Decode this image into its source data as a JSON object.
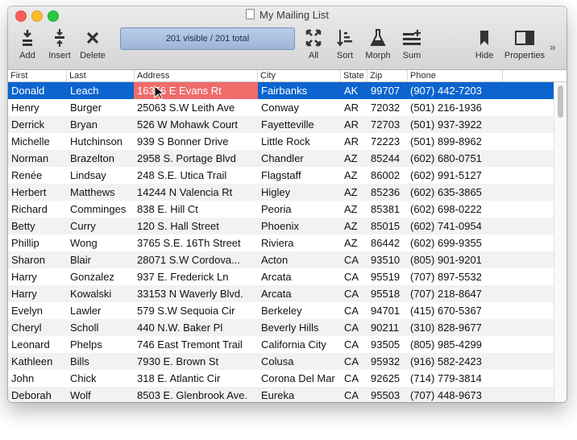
{
  "window": {
    "title": "My Mailing List"
  },
  "toolbar": {
    "add": "Add",
    "insert": "Insert",
    "delete": "Delete",
    "status": "201 visible / 201 total",
    "all": "All",
    "sort": "Sort",
    "morph": "Morph",
    "sum": "Sum",
    "hide": "Hide",
    "properties": "Properties",
    "more": "»"
  },
  "columns": [
    "First",
    "Last",
    "Address",
    "City",
    "State",
    "Zip",
    "Phone"
  ],
  "rows": [
    [
      "Donald",
      "Leach",
      "16356 E Evans Rt",
      "Fairbanks",
      "AK",
      "99707",
      "(907) 442-7203"
    ],
    [
      "Henry",
      "Burger",
      "25063 S.W Leith Ave",
      "Conway",
      "AR",
      "72032",
      "(501) 216-1936"
    ],
    [
      "Derrick",
      "Bryan",
      "526 W Mohawk Court",
      "Fayetteville",
      "AR",
      "72703",
      "(501) 937-3922"
    ],
    [
      "Michelle",
      "Hutchinson",
      "939 S Bonner Drive",
      "Little Rock",
      "AR",
      "72223",
      "(501) 899-8962"
    ],
    [
      "Norman",
      "Brazelton",
      "2958 S. Portage Blvd",
      "Chandler",
      "AZ",
      "85244",
      "(602) 680-0751"
    ],
    [
      "Renée",
      "Lindsay",
      "248 S.E. Utica Trail",
      "Flagstaff",
      "AZ",
      "86002",
      "(602) 991-5127"
    ],
    [
      "Herbert",
      "Matthews",
      "14244 N Valencia Rt",
      "Higley",
      "AZ",
      "85236",
      "(602) 635-3865"
    ],
    [
      "Richard",
      "Comminges",
      "838 E. Hill Ct",
      "Peoria",
      "AZ",
      "85381",
      "(602) 698-0222"
    ],
    [
      "Betty",
      "Curry",
      "120 S. Hall Street",
      "Phoenix",
      "AZ",
      "85015",
      "(602) 741-0954"
    ],
    [
      "Phillip",
      "Wong",
      "3765 S.E. 16Th Street",
      "Riviera",
      "AZ",
      "86442",
      "(602) 699-9355"
    ],
    [
      "Sharon",
      "Blair",
      "28071 S.W Cordova...",
      "Acton",
      "CA",
      "93510",
      "(805) 901-9201"
    ],
    [
      "Harry",
      "Gonzalez",
      "937 E. Frederick Ln",
      "Arcata",
      "CA",
      "95519",
      "(707) 897-5532"
    ],
    [
      "Harry",
      "Kowalski",
      "33153 N Waverly Blvd.",
      "Arcata",
      "CA",
      "95518",
      "(707) 218-8647"
    ],
    [
      "Evelyn",
      "Lawler",
      "579 S.W Sequoia Cir",
      "Berkeley",
      "CA",
      "94701",
      "(415) 670-5367"
    ],
    [
      "Cheryl",
      "Scholl",
      "440 N.W. Baker Pl",
      "Beverly Hills",
      "CA",
      "90211",
      "(310) 828-9677"
    ],
    [
      "Leonard",
      "Phelps",
      "746 East Tremont Trail",
      "California City",
      "CA",
      "93505",
      "(805) 985-4299"
    ],
    [
      "Kathleen",
      "Bills",
      "7930 E. Brown St",
      "Colusa",
      "CA",
      "95932",
      "(916) 582-2423"
    ],
    [
      "John",
      "Chick",
      "318 E. Atlantic Cir",
      "Corona Del Mar",
      "CA",
      "92625",
      "(714) 779-3814"
    ],
    [
      "Deborah",
      "Wolf",
      "8503 E. Glenbrook Ave.",
      "Eureka",
      "CA",
      "95503",
      "(707) 448-9673"
    ]
  ],
  "colors": {
    "selection": "#0c64cf",
    "editing_cell": "#ee6c6a"
  }
}
